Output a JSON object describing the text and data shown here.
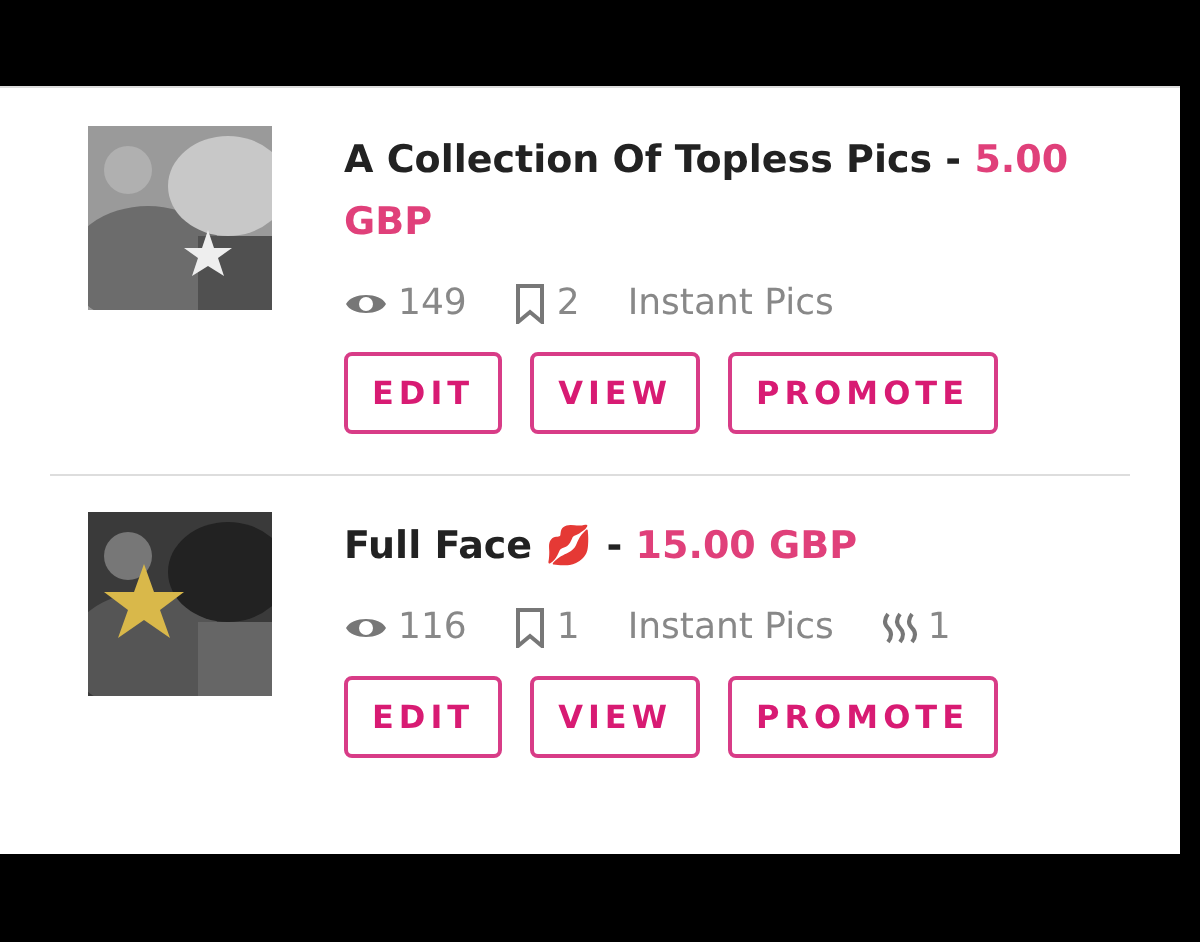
{
  "listings": [
    {
      "title": "A Collection Of Topless Pics",
      "separator": "-",
      "price": "5.00 GBP",
      "stats": [
        {
          "kind": "views",
          "text": "149"
        },
        {
          "kind": "saves",
          "text": "2"
        },
        {
          "kind": "category",
          "text": "Instant Pics"
        }
      ],
      "buttons": [
        "EDIT",
        "VIEW",
        "PROMOTE"
      ]
    },
    {
      "title": "Full Face 💋",
      "separator": "-",
      "price": "15.00 GBP",
      "stats": [
        {
          "kind": "views",
          "text": "116"
        },
        {
          "kind": "saves",
          "text": "1"
        },
        {
          "kind": "category",
          "text": "Instant Pics"
        },
        {
          "kind": "heat",
          "text": "1"
        }
      ],
      "buttons": [
        "EDIT",
        "VIEW",
        "PROMOTE"
      ]
    }
  ]
}
